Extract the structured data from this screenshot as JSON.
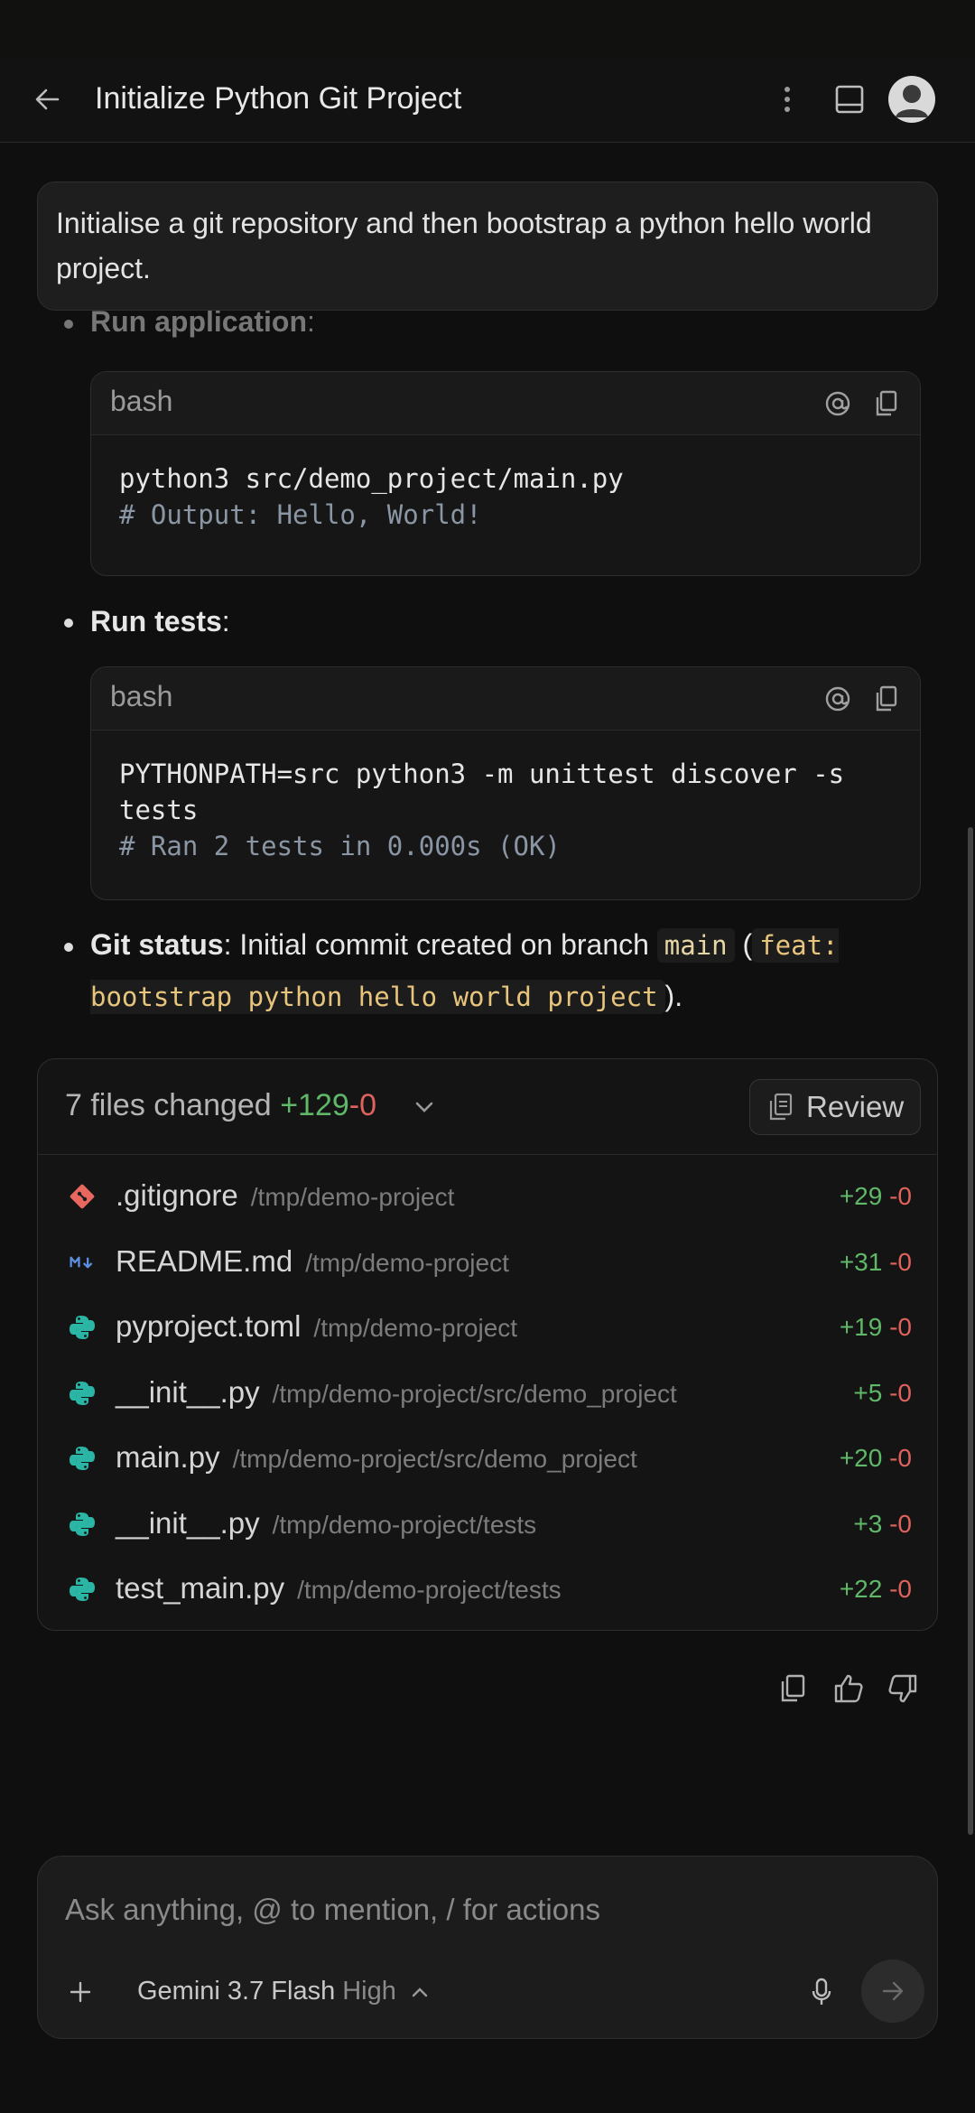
{
  "header": {
    "title": "Initialize Python Git Project"
  },
  "user_message": "Initialise a git repository and then bootstrap a python hello world project.",
  "steps": {
    "run_app": {
      "label": "Run application",
      "colon": ":"
    },
    "run_app_code": {
      "lang": "bash",
      "line1": "python3 src/demo_project/main.py",
      "comment": "# Output: Hello, World!"
    },
    "run_tests": {
      "label": "Run tests",
      "colon": ":"
    },
    "run_tests_code": {
      "lang": "bash",
      "line1": "PYTHONPATH=src python3 -m unittest discover -s tests",
      "comment": "# Ran 2 tests in 0.000s (OK)"
    },
    "git_status": {
      "label": "Git status",
      "text1": ": Initial commit created on branch ",
      "branch": "main",
      "open_paren": " (",
      "commit": "feat: bootstrap python hello world project",
      "close_paren": ")."
    }
  },
  "files_changed": {
    "summary": "7 files changed",
    "added": "+129",
    "removed": "-0",
    "review_label": "Review",
    "files": [
      {
        "name": ".gitignore",
        "path": "/tmp/demo-project",
        "added": "+29",
        "removed": "-0",
        "icon": "git-icon"
      },
      {
        "name": "README.md",
        "path": "/tmp/demo-project",
        "added": "+31",
        "removed": "-0",
        "icon": "markdown-icon"
      },
      {
        "name": "pyproject.toml",
        "path": "/tmp/demo-project",
        "added": "+19",
        "removed": "-0",
        "icon": "python-icon"
      },
      {
        "name": "__init__.py",
        "path": "/tmp/demo-project/src/demo_project",
        "added": "+5",
        "removed": "-0",
        "icon": "python-icon"
      },
      {
        "name": "main.py",
        "path": "/tmp/demo-project/src/demo_project",
        "added": "+20",
        "removed": "-0",
        "icon": "python-icon"
      },
      {
        "name": "__init__.py",
        "path": "/tmp/demo-project/tests",
        "added": "+3",
        "removed": "-0",
        "icon": "python-icon"
      },
      {
        "name": "test_main.py",
        "path": "/tmp/demo-project/tests",
        "added": "+22",
        "removed": "-0",
        "icon": "python-icon"
      }
    ]
  },
  "composer": {
    "placeholder": "Ask anything, @ to mention, / for actions",
    "model": "Gemini 3.7 Flash",
    "level": "High"
  },
  "colors": {
    "added": "#5fb768",
    "removed": "#e0625d",
    "python": "#2bb5a4",
    "git": "#e8685f",
    "markdown": "#5b8fe0"
  }
}
